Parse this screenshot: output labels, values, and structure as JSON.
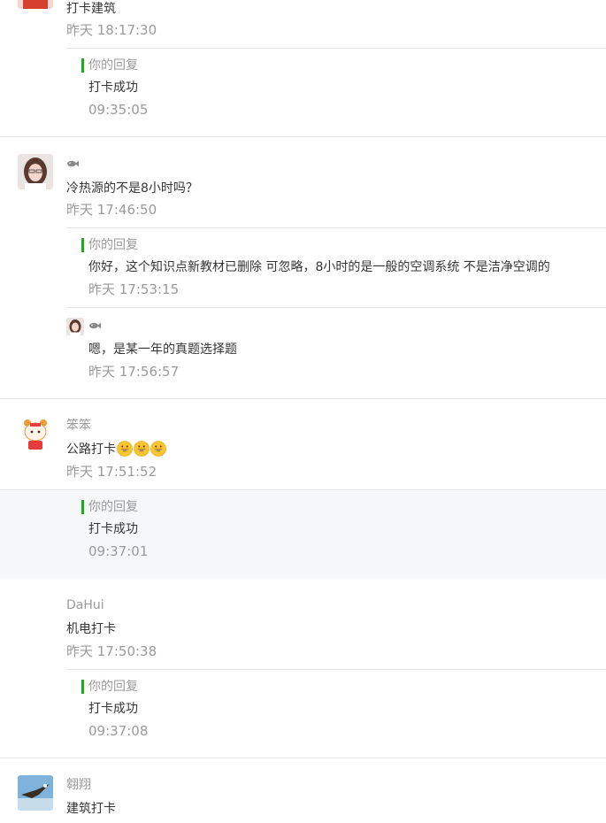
{
  "comments": [
    {
      "avatar_icon": "red-hair-girl-avatar-icon",
      "content": "打卡建筑",
      "time": "昨天 18:17:30",
      "reply": {
        "label": "你的回复",
        "text": "打卡成功",
        "time": "09:35:05"
      }
    },
    {
      "avatar_icon": "girl-portrait-avatar-icon",
      "nickname_icon": "fish-icon",
      "content": "冷热源的不是8小时吗？",
      "time": "昨天 17:46:50",
      "reply": {
        "label": "你的回复",
        "text": "你好，这个知识点新教材已删除  可忽略，8小时的是一般的空调系统 不是洁净空调的",
        "time": "昨天 17:53:15"
      },
      "sub_reply": {
        "avatar_icon": "girl-portrait-avatar-icon",
        "nickname_icon": "fish-icon",
        "text": "嗯，是某一年的真题选择题",
        "time": "昨天 17:56:57"
      }
    },
    {
      "avatar_icon": "cartoon-tiger-avatar-icon",
      "nickname": "笨笨",
      "content": "公路打卡",
      "emoji_icons": [
        "grin-emoji-icon",
        "grin-emoji-icon",
        "grin-emoji-icon"
      ],
      "time": "昨天 17:51:52",
      "reply": {
        "label": "你的回复",
        "text": "打卡成功",
        "time": "09:37:01"
      }
    },
    {
      "nickname": "DaHui",
      "content": "机电打卡",
      "time": "昨天 17:50:38",
      "reply": {
        "label": "你的回复",
        "text": "打卡成功",
        "time": "09:37:08"
      }
    },
    {
      "avatar_icon": "eagle-avatar-icon",
      "nickname": "翱翔",
      "content": "建筑打卡"
    }
  ],
  "colors": {
    "accent": "#1aad19",
    "text": "#353535",
    "meta": "#9a9a9a",
    "divider": "#e5e5e5",
    "highlight_bg": "#f6f7f9"
  }
}
